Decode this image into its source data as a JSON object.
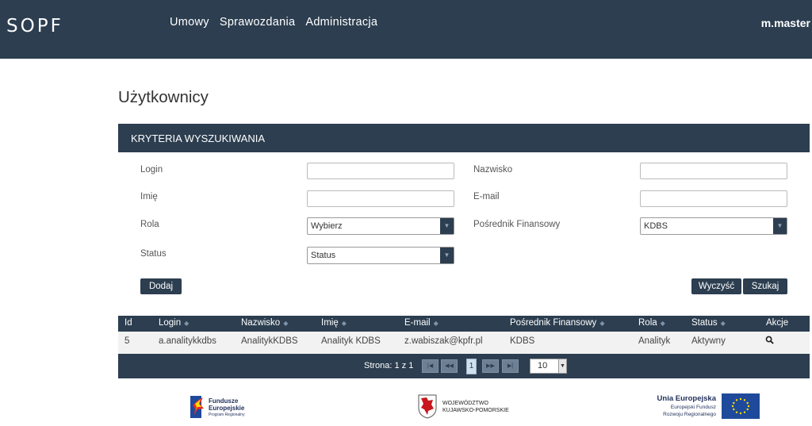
{
  "app": {
    "logo": "SOPF",
    "user": "m.master"
  },
  "nav": {
    "items": [
      "Umowy",
      "Sprawozdania",
      "Administracja"
    ]
  },
  "page": {
    "title": "Użytkownicy"
  },
  "criteria": {
    "header": "KRYTERIA WYSZUKIWANIA",
    "login_label": "Login",
    "login_value": "",
    "nazwisko_label": "Nazwisko",
    "nazwisko_value": "",
    "imie_label": "Imię",
    "imie_value": "",
    "email_label": "E-mail",
    "email_value": "",
    "rola_label": "Rola",
    "rola_value": "Wybierz",
    "posrednik_label": "Pośrednik Finansowy",
    "posrednik_value": "KDBS",
    "status_label": "Status",
    "status_value": "Status"
  },
  "buttons": {
    "dodaj": "Dodaj",
    "wyczysc": "Wyczyść",
    "szukaj": "Szukaj"
  },
  "table": {
    "columns": [
      "Id",
      "Login",
      "Nazwisko",
      "Imię",
      "E-mail",
      "Pośrednik Finansowy",
      "Rola",
      "Status",
      "Akcje"
    ],
    "rows": [
      {
        "id": "5",
        "login": "a.analitykkdbs",
        "nazwisko": "AnalitykKDBS",
        "imie": "Analityk KDBS",
        "email": "z.wabiszak@kpfr.pl",
        "posrednik": "KDBS",
        "rola": "Analityk",
        "status": "Aktywny"
      }
    ]
  },
  "pager": {
    "text": "Strona: 1 z 1",
    "current": "1",
    "page_size": "10"
  },
  "footer": {
    "fe_line1": "Fundusze",
    "fe_line2": "Europejskie",
    "fe_line3": "Program Regionalny",
    "woj_line1": "WOJEWÓDZTWO",
    "woj_line2": "KUJAWSKO-POMORSKIE",
    "ue_line1": "Unia Europejska",
    "ue_line2": "Europejski Fundusz",
    "ue_line3": "Rozwoju Regionalnego"
  },
  "colors": {
    "primary": "#2c3e50",
    "eu_blue": "#1f4a9b",
    "eu_star": "#ffde00"
  }
}
